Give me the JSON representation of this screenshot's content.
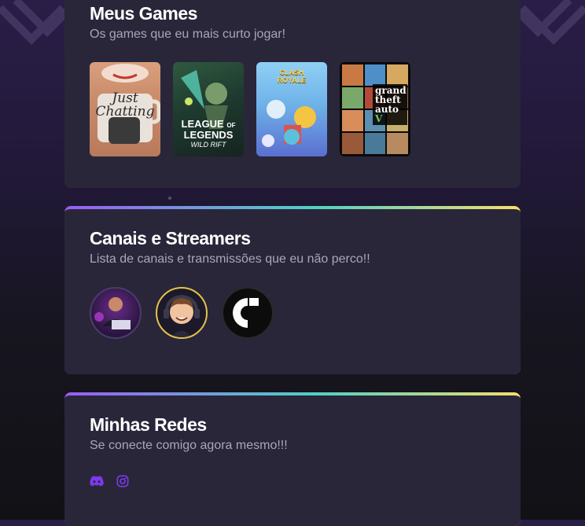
{
  "games_section": {
    "title": "Meus Games",
    "subtitle": "Os games que eu mais curto jogar!",
    "games": [
      {
        "name": "Just Chatting",
        "art_text_1": "Just",
        "art_text_2": "Chatting"
      },
      {
        "name": "League of Legends Wild Rift",
        "art_text_1": "LEAGUE",
        "art_text_2": "OF",
        "art_text_3": "LEGENDS",
        "art_text_4": "WILD RIFT"
      },
      {
        "name": "Clash Royale",
        "art_text_1": "CLASH",
        "art_text_2": "ROYALE"
      },
      {
        "name": "Grand Theft Auto V",
        "art_text_1": "grand",
        "art_text_2": "theft",
        "art_text_3": "auto",
        "art_text_4": "V"
      }
    ]
  },
  "streamers_section": {
    "title": "Canais e Streamers",
    "subtitle": "Lista de canais e transmissões que eu não perco!!",
    "streamers": [
      {
        "avatar": "streamer-avatar-1"
      },
      {
        "avatar": "streamer-avatar-2"
      },
      {
        "avatar": "streamer-avatar-3"
      }
    ]
  },
  "social_section": {
    "title": "Minhas Redes",
    "subtitle": "Se conecte comigo agora mesmo!!!",
    "links": [
      {
        "icon": "discord-icon"
      },
      {
        "icon": "instagram-icon"
      }
    ]
  },
  "colors": {
    "card_bg": "#29263a",
    "accent_purple": "#7c3aed",
    "gradient": [
      "#9b5cf6",
      "#4fd1c5",
      "#f5e06a"
    ]
  }
}
